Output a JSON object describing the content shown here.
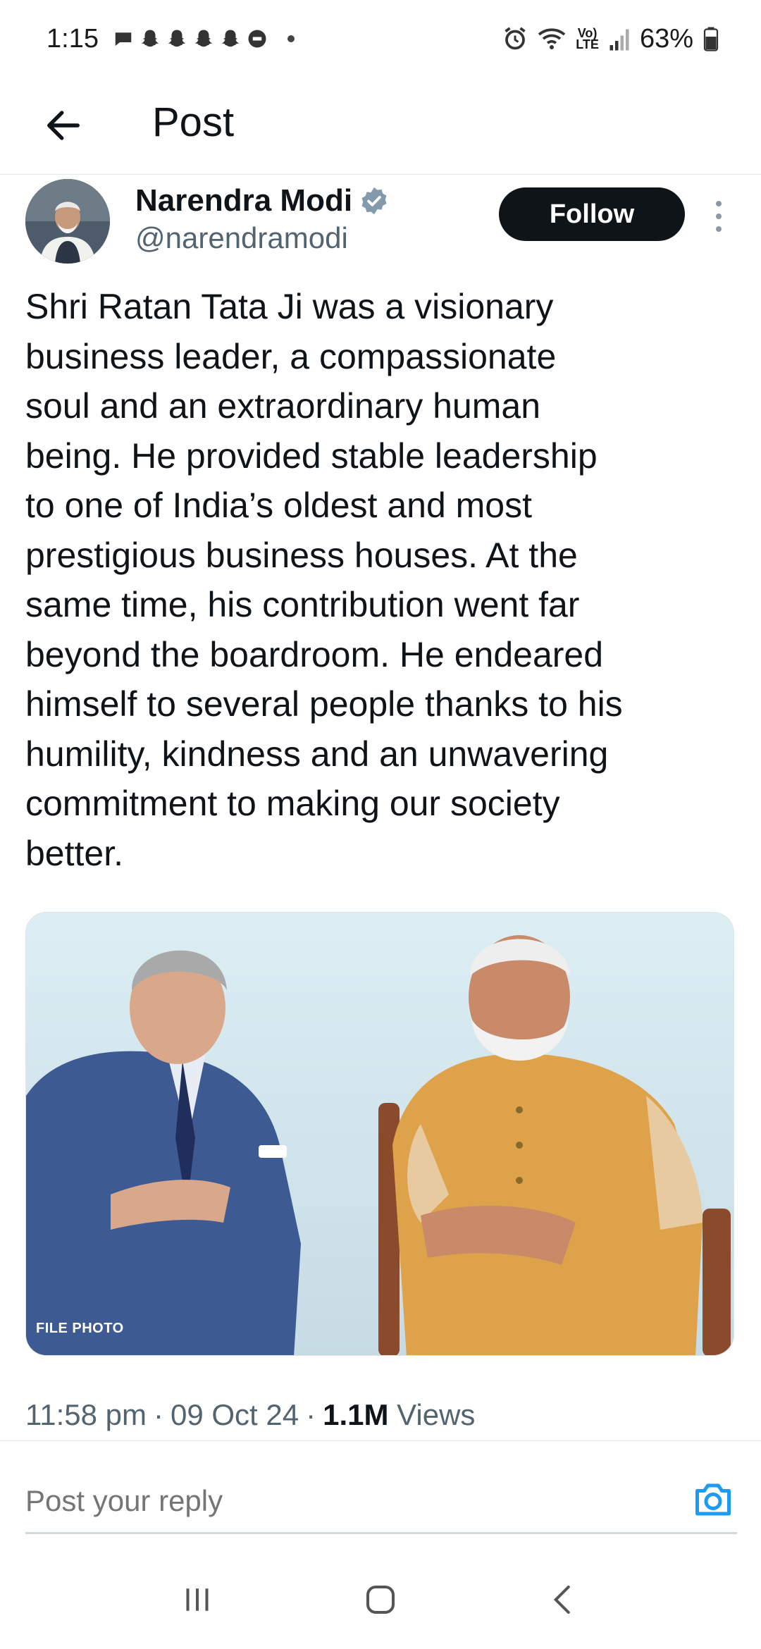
{
  "status_bar": {
    "time": "1:15",
    "battery": "63%",
    "notification_icons": [
      "messages-icon",
      "snapchat-icon",
      "snapchat-icon",
      "snapchat-icon",
      "snapchat-icon",
      "news-icon"
    ],
    "system_icons": [
      "alarm-icon",
      "wifi-icon",
      "volte-icon",
      "signal-icon",
      "battery-icon"
    ],
    "volte_label": "Vo)\nLTE"
  },
  "header": {
    "title": "Post"
  },
  "post": {
    "author_name": "Narendra Modi",
    "handle": "@narendramodi",
    "follow_label": "Follow",
    "text": "Shri Ratan Tata Ji was a visionary\nbusiness leader, a compassionate\nsoul and an extraordinary human\nbeing. He provided stable leadership\nto one of India’s oldest and most\nprestigious business houses. At the\nsame time, his contribution went far\nbeyond the boardroom. He endeared\nhimself to several people thanks to his\nhumility, kindness and an unwavering\ncommitment to making our society\nbetter.",
    "media_caption": "FILE PHOTO",
    "time": "11:58 pm",
    "date": "09 Oct 24",
    "views_count": "1.1M",
    "views_label": "Views",
    "separator": "·"
  },
  "reply": {
    "placeholder": "Post your reply"
  },
  "colors": {
    "accent": "#1d9bf0",
    "text_primary": "#0f1419",
    "text_secondary": "#536471",
    "verified": "#829aab"
  }
}
